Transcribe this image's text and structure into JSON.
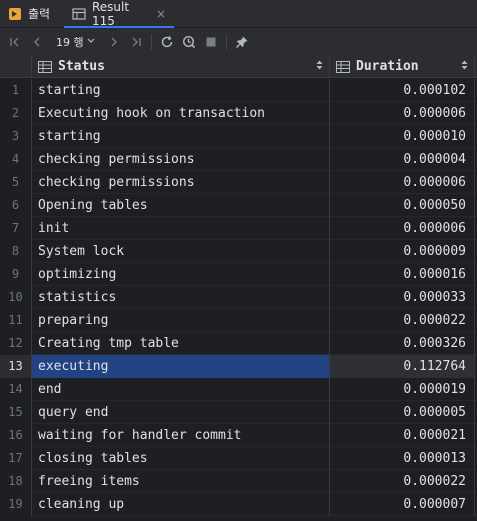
{
  "tabs": [
    {
      "label": "출력",
      "icon": "output-icon",
      "active": false
    },
    {
      "label": "Result 115",
      "icon": "table-icon",
      "active": true,
      "close": "×"
    }
  ],
  "toolbar": {
    "rows_label": "19 행",
    "buttons": [
      "first-page-icon",
      "prev-page-icon",
      "next-page-icon",
      "last-page-icon",
      "refresh-icon",
      "history-icon",
      "stop-icon",
      "pin-icon"
    ]
  },
  "grid": {
    "columns": [
      "Status",
      "Duration"
    ],
    "selected_row": 13,
    "rows": [
      {
        "n": "1",
        "status": "starting",
        "duration": "0.000102"
      },
      {
        "n": "2",
        "status": "Executing hook on transaction",
        "duration": "0.000006"
      },
      {
        "n": "3",
        "status": "starting",
        "duration": "0.000010"
      },
      {
        "n": "4",
        "status": "checking permissions",
        "duration": "0.000004"
      },
      {
        "n": "5",
        "status": "checking permissions",
        "duration": "0.000006"
      },
      {
        "n": "6",
        "status": "Opening tables",
        "duration": "0.000050"
      },
      {
        "n": "7",
        "status": "init",
        "duration": "0.000006"
      },
      {
        "n": "8",
        "status": "System lock",
        "duration": "0.000009"
      },
      {
        "n": "9",
        "status": "optimizing",
        "duration": "0.000016"
      },
      {
        "n": "10",
        "status": "statistics",
        "duration": "0.000033"
      },
      {
        "n": "11",
        "status": "preparing",
        "duration": "0.000022"
      },
      {
        "n": "12",
        "status": "Creating tmp table",
        "duration": "0.000326"
      },
      {
        "n": "13",
        "status": "executing",
        "duration": "0.112764"
      },
      {
        "n": "14",
        "status": "end",
        "duration": "0.000019"
      },
      {
        "n": "15",
        "status": "query end",
        "duration": "0.000005"
      },
      {
        "n": "16",
        "status": "waiting for handler commit",
        "duration": "0.000021"
      },
      {
        "n": "17",
        "status": "closing tables",
        "duration": "0.000013"
      },
      {
        "n": "18",
        "status": "freeing items",
        "duration": "0.000022"
      },
      {
        "n": "19",
        "status": "cleaning up",
        "duration": "0.000007"
      }
    ]
  }
}
